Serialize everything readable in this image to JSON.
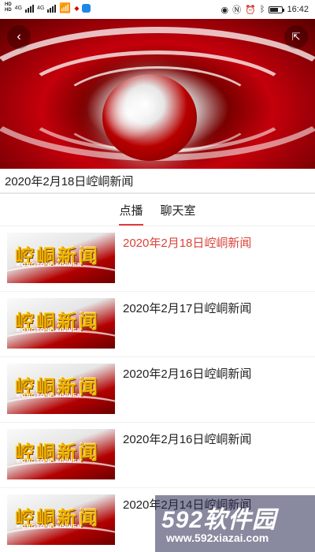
{
  "status_bar": {
    "time": "16:42",
    "battery": "",
    "battery_level": 0.7,
    "sim1": "HD",
    "sim2": "HD",
    "net1": "4G",
    "net2": "4G",
    "icons": [
      "eye-icon",
      "nfc-icon",
      "alarm-icon",
      "bluetooth-icon",
      "battery-icon"
    ]
  },
  "video": {
    "title": "2020年2月18日崆峒新闻",
    "back_icon": "back-icon",
    "share_icon": "share-icon"
  },
  "tabs": [
    {
      "label": "点播",
      "active": true
    },
    {
      "label": "聊天室",
      "active": false
    }
  ],
  "list": {
    "items": [
      {
        "title": "2020年2月18日崆峒新闻",
        "active": true
      },
      {
        "title": "2020年2月17日崆峒新闻",
        "active": false
      },
      {
        "title": "2020年2月16日崆峒新闻",
        "active": false
      },
      {
        "title": "2020年2月16日崆峒新闻",
        "active": false
      },
      {
        "title": "2020年2月14日崆峒新闻",
        "active": false
      }
    ],
    "thumb_logo": "崆峒新闻",
    "thumb_sub": "KONGTONGXINWEN"
  },
  "watermark": {
    "main": "592软件园",
    "url": "www.592xiazai.com"
  },
  "colors": {
    "accent": "#e4393c",
    "active_text": "#d9443a"
  }
}
